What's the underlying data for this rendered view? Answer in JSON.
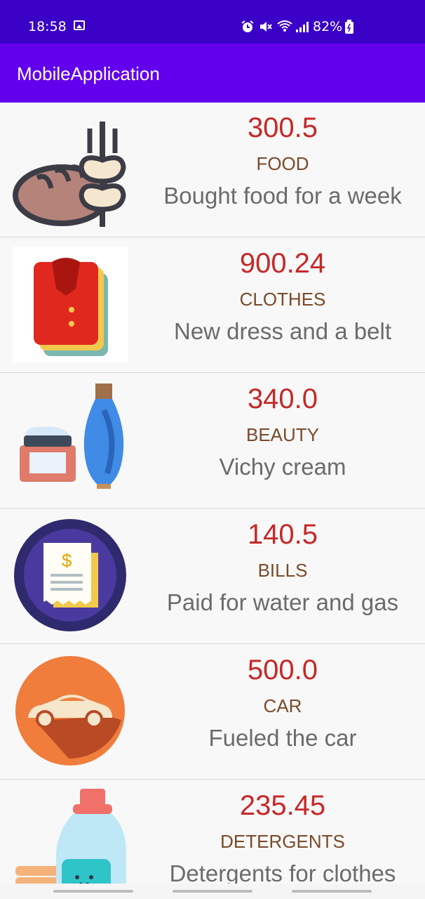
{
  "status": {
    "time": "18:58",
    "battery": "82%",
    "icons": [
      "gallery-icon",
      "alarm-icon",
      "mute-icon",
      "wifi-icon",
      "signal-icon",
      "battery-icon"
    ]
  },
  "appbar": {
    "title": "MobileApplication"
  },
  "items": [
    {
      "amount": "300.5",
      "category": "FOOD",
      "description": "Bought food for a week",
      "icon": "bread-wheat-icon"
    },
    {
      "amount": "900.24",
      "category": "CLOTHES",
      "description": "New dress and a belt",
      "icon": "clothes-stack-icon"
    },
    {
      "amount": "340.0",
      "category": "BEAUTY",
      "description": "Vichy cream",
      "icon": "cosmetics-icon"
    },
    {
      "amount": "140.5",
      "category": "BILLS",
      "description": "Paid for water and gas",
      "icon": "receipt-icon"
    },
    {
      "amount": "500.0",
      "category": "CAR",
      "description": "Fueled the car",
      "icon": "car-icon"
    },
    {
      "amount": "235.45",
      "category": "DETERGENTS",
      "description": "Detergents for clothes",
      "icon": "detergent-bottle-icon"
    }
  ],
  "colors": {
    "statusbar": "#3a00c8",
    "appbar": "#6200ee",
    "amount": "#c62828",
    "category": "#7a4a2a",
    "description": "#6b6b6b"
  }
}
